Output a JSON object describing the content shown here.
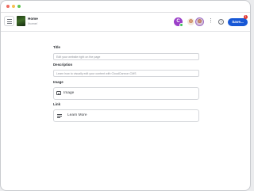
{
  "header": {
    "page_name": "Home",
    "page_path": "/home/",
    "avatar_initial": "C",
    "more_glyph": "⋮",
    "help_glyph": "?",
    "save_label": "Save...",
    "notification_count": "1"
  },
  "form": {
    "title_label": "Title",
    "title_placeholder": "Edit your website right on the page",
    "description_label": "Description",
    "description_placeholder": "Learn how to visually edit your content with CloudCannon CMS",
    "image_label": "Image",
    "image_button": "Image",
    "link_label": "Link",
    "link_button": "Learn More"
  },
  "colors": {
    "accent": "#1858d6",
    "badge": "#e0352f",
    "avatar": "#9b3fc8"
  },
  "icons": [
    "menu-icon",
    "more-vertical-icon",
    "help-icon",
    "image-icon",
    "list-icon"
  ]
}
